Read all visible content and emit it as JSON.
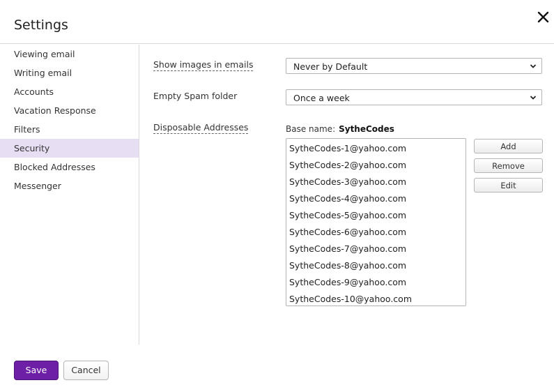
{
  "header": {
    "title": "Settings",
    "close_icon": "close-icon"
  },
  "sidebar": {
    "items": [
      {
        "label": "Viewing email",
        "active": false
      },
      {
        "label": "Writing email",
        "active": false
      },
      {
        "label": "Accounts",
        "active": false
      },
      {
        "label": "Vacation Response",
        "active": false
      },
      {
        "label": "Filters",
        "active": false
      },
      {
        "label": "Security",
        "active": true
      },
      {
        "label": "Blocked Addresses",
        "active": false
      },
      {
        "label": "Messenger",
        "active": false
      }
    ],
    "active_color": "#e8def4"
  },
  "security": {
    "show_images_label": "Show images in emails",
    "show_images_value": "Never by Default",
    "empty_spam_label": "Empty Spam folder",
    "empty_spam_value": "Once a week",
    "disposable_label": "Disposable Addresses",
    "base_name_label": "Base name:",
    "base_name_value": "SytheCodes",
    "addresses": [
      "SytheCodes-1@yahoo.com",
      "SytheCodes-2@yahoo.com",
      "SytheCodes-3@yahoo.com",
      "SytheCodes-4@yahoo.com",
      "SytheCodes-5@yahoo.com",
      "SytheCodes-6@yahoo.com",
      "SytheCodes-7@yahoo.com",
      "SytheCodes-8@yahoo.com",
      "SytheCodes-9@yahoo.com",
      "SytheCodes-10@yahoo.com"
    ],
    "add_label": "Add",
    "remove_label": "Remove",
    "edit_label": "Edit"
  },
  "footer": {
    "save_label": "Save",
    "cancel_label": "Cancel",
    "accent_color": "#6d1fa6"
  }
}
